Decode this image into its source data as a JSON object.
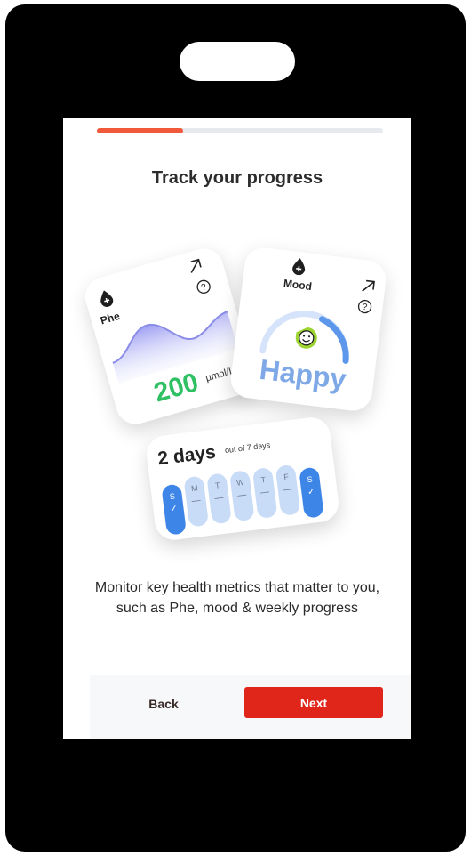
{
  "progress": {
    "value": 0.3
  },
  "title": "Track your progress",
  "phe_card": {
    "label": "Phe",
    "value": "200",
    "unit": "μmol/L"
  },
  "mood_card": {
    "label": "Mood",
    "value": "Happy"
  },
  "days_card": {
    "count": "2 days",
    "suffix": "out of 7 days",
    "days": [
      {
        "letter": "S",
        "mark": "✓",
        "active": true
      },
      {
        "letter": "M",
        "mark": "—",
        "active": false
      },
      {
        "letter": "T",
        "mark": "—",
        "active": false
      },
      {
        "letter": "W",
        "mark": "—",
        "active": false
      },
      {
        "letter": "T",
        "mark": "—",
        "active": false
      },
      {
        "letter": "F",
        "mark": "—",
        "active": false
      },
      {
        "letter": "S",
        "mark": "✓",
        "active": true
      }
    ]
  },
  "description": "Monitor key health metrics that matter to you, such as Phe, mood & weekly progress",
  "buttons": {
    "back": "Back",
    "next": "Next"
  },
  "colors": {
    "accent": "#e0251b",
    "progress": "#f05a3a",
    "phe_value": "#2fc063",
    "mood_value": "#7fa8e6",
    "day_active": "#3d86e8"
  },
  "icons": [
    "drop-icon",
    "arrow-up-right-icon",
    "help-icon",
    "smiley-icon",
    "check-icon"
  ]
}
